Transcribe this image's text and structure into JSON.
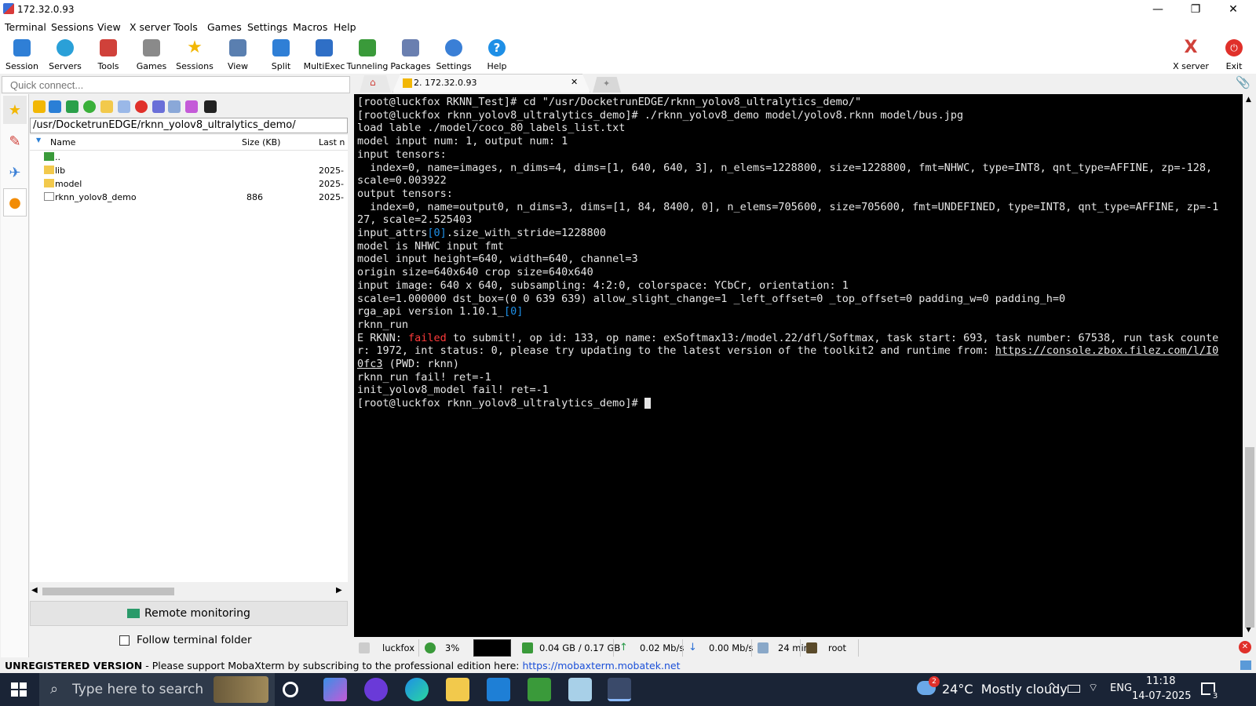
{
  "window": {
    "title": "172.32.0.93",
    "minimize": "—",
    "maximize": "❐",
    "close": "✕"
  },
  "menubar": [
    "Terminal",
    "Sessions",
    "View",
    "X server",
    "Tools",
    "Games",
    "Settings",
    "Macros",
    "Help"
  ],
  "toolbar": {
    "items": [
      {
        "label": "Session",
        "icon": "session-icon",
        "color": "#2f7fd6"
      },
      {
        "label": "Servers",
        "icon": "servers-icon",
        "color": "#2aa0d8"
      },
      {
        "label": "Tools",
        "icon": "tools-icon",
        "color": "#d0413a"
      },
      {
        "label": "Games",
        "icon": "games-icon",
        "color": "#8a8a8a"
      },
      {
        "label": "Sessions",
        "icon": "star-icon",
        "color": "#f2b705"
      },
      {
        "label": "View",
        "icon": "view-icon",
        "color": "#5a7fb0"
      },
      {
        "label": "Split",
        "icon": "split-icon",
        "color": "#2f7fd6"
      },
      {
        "label": "MultiExec",
        "icon": "multiexec-icon",
        "color": "#2f6fc6"
      },
      {
        "label": "Tunneling",
        "icon": "tunneling-icon",
        "color": "#3a9a3a"
      },
      {
        "label": "Packages",
        "icon": "packages-icon",
        "color": "#6a7fb0"
      },
      {
        "label": "Settings",
        "icon": "settings-icon",
        "color": "#3a7fd6"
      },
      {
        "label": "Help",
        "icon": "help-icon",
        "color": "#1e8fe6"
      }
    ],
    "xserver_label": "X server",
    "exit_label": "Exit"
  },
  "quick_connect": {
    "placeholder": "Quick connect..."
  },
  "sftp": {
    "path": "/usr/DocketrunEDGE/rknn_yolov8_ultralytics_demo/",
    "columns": {
      "name": "Name",
      "size": "Size (KB)",
      "last": "Last n"
    },
    "rows": [
      {
        "name": "..",
        "size": "",
        "date": ""
      },
      {
        "name": "lib",
        "size": "",
        "date": "2025-"
      },
      {
        "name": "model",
        "size": "",
        "date": "2025-"
      },
      {
        "name": "rknn_yolov8_demo",
        "size": "886",
        "date": "2025-"
      }
    ],
    "remote_monitoring": "Remote monitoring",
    "follow_terminal": "Follow terminal folder"
  },
  "tabs": {
    "active": "2. 172.32.0.93"
  },
  "terminal": {
    "lines": [
      [
        {
          "t": "[root@luckfox RKNN_Test]# cd \"/usr/DocketrunEDGE/rknn_yolov8_ultralytics_demo/\""
        }
      ],
      [
        {
          "t": "[root@luckfox rknn_yolov8_ultralytics_demo]# ./rknn_yolov8_demo model/yolov8.rknn model/bus.jpg"
        }
      ],
      [
        {
          "t": "load lable ./model/coco_80_labels_list.txt"
        }
      ],
      [
        {
          "t": "model input num: 1, output num: 1"
        }
      ],
      [
        {
          "t": "input tensors:"
        }
      ],
      [
        {
          "t": "  index=0, name=images, n_dims=4, dims=[1, 640, 640, 3], n_elems=1228800, size=1228800, fmt=NHWC, type=INT8, qnt_type=AFFINE, zp=-128,"
        }
      ],
      [
        {
          "t": "scale=0.003922"
        }
      ],
      [
        {
          "t": "output tensors:"
        }
      ],
      [
        {
          "t": "  index=0, name=output0, n_dims=3, dims=[1, 84, 8400, 0], n_elems=705600, size=705600, fmt=UNDEFINED, type=INT8, qnt_type=AFFINE, zp=-1"
        }
      ],
      [
        {
          "t": "27, scale=2.525403"
        }
      ],
      [
        {
          "t": "input_attrs"
        },
        {
          "t": "[0]",
          "c": "#1e8fe6"
        },
        {
          "t": ".size_with_stride=1228800"
        }
      ],
      [
        {
          "t": "model is NHWC input fmt"
        }
      ],
      [
        {
          "t": "model input height=640, width=640, channel=3"
        }
      ],
      [
        {
          "t": "origin size=640x640 crop size=640x640"
        }
      ],
      [
        {
          "t": "input image: 640 x 640, subsampling: 4:2:0, colorspace: YCbCr, orientation: 1"
        }
      ],
      [
        {
          "t": "scale=1.000000 dst_box=(0 0 639 639) allow_slight_change=1 _left_offset=0 _top_offset=0 padding_w=0 padding_h=0"
        }
      ],
      [
        {
          "t": "rga_api version 1.10.1_"
        },
        {
          "t": "[0]",
          "c": "#1e8fe6"
        }
      ],
      [
        {
          "t": "rknn_run"
        }
      ],
      [
        {
          "t": "E RKNN: "
        },
        {
          "t": "failed",
          "c": "#ff3b3b"
        },
        {
          "t": " to submit!, op id: 133, op name: exSoftmax13:/model.22/dfl/Softmax, task start: 693, task number: 67538, run task counte"
        }
      ],
      [
        {
          "t": "r: 1972, int status: 0, please try updating to the latest version of the toolkit2 and runtime from: "
        },
        {
          "t": "https://console.zbox.filez.com/l/I0",
          "u": true
        }
      ],
      [
        {
          "t": "0fc3",
          "u": true
        },
        {
          "t": " (PWD: rknn)"
        }
      ],
      [
        {
          "t": "rknn_run fail! ret=-1"
        }
      ],
      [
        {
          "t": "init_yolov8_model fail! ret=-1"
        }
      ],
      [
        {
          "t": "[root@luckfox rknn_yolov8_ultralytics_demo]# "
        }
      ]
    ]
  },
  "status": {
    "host": "luckfox",
    "cpu": "3%",
    "mem": "0.04 GB / 0.17 GB",
    "up": "0.02 Mb/s",
    "down": "0.00 Mb/s",
    "uptime": "24 min",
    "user": "root"
  },
  "unregistered": {
    "label": "UNREGISTERED VERSION",
    "message": " -  Please support MobaXterm by subscribing to the professional edition here: ",
    "link": "https://mobaxterm.mobatek.net"
  },
  "taskbar": {
    "search_placeholder": "Type here to search",
    "weather_badge": "2",
    "weather": "24°C  Mostly cloudy",
    "lang": "ENG",
    "time": "11:18",
    "date": "14-07-2025",
    "notifications": "3"
  }
}
